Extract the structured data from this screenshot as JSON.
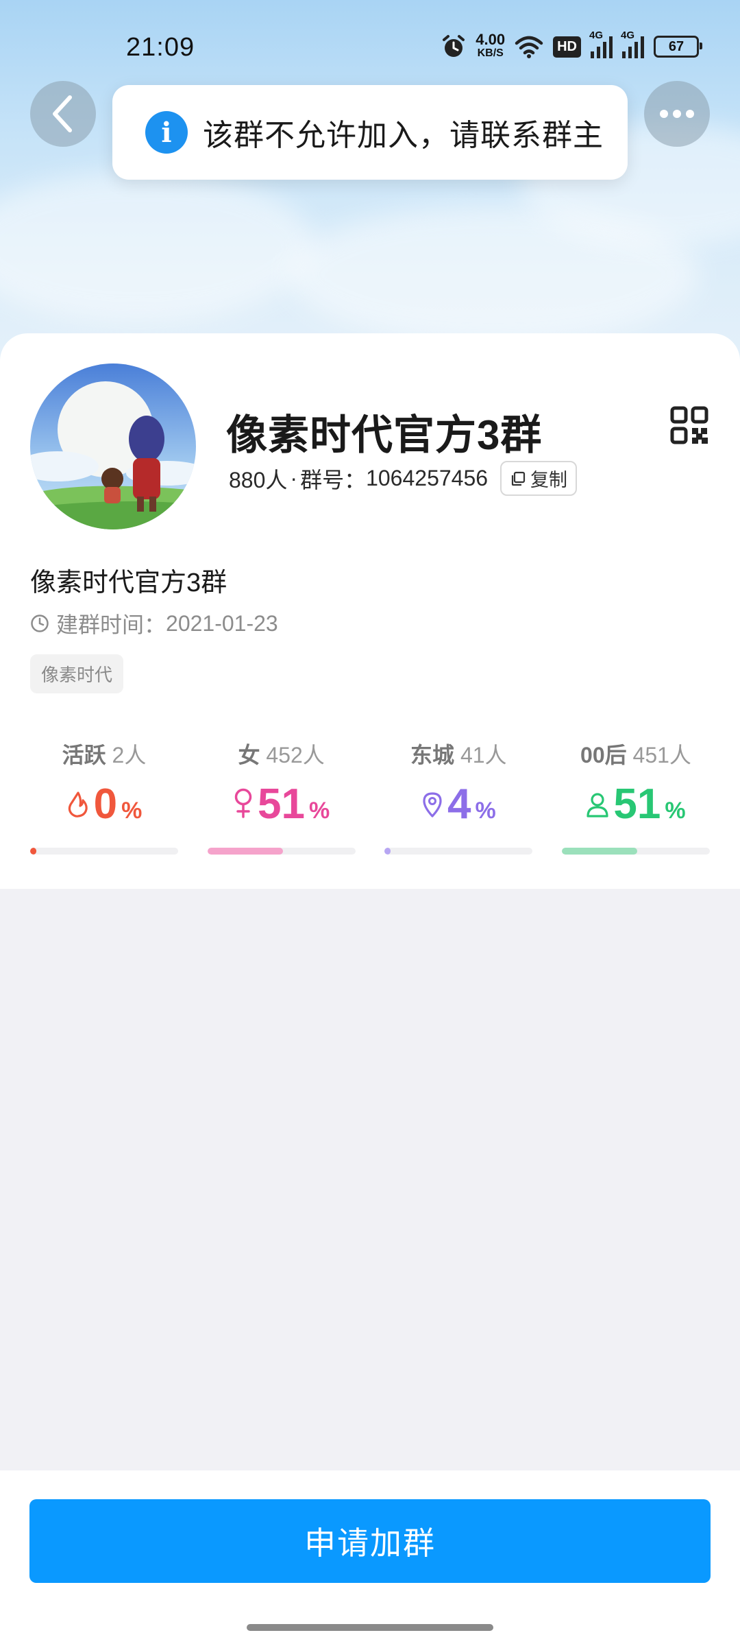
{
  "status_bar": {
    "time": "21:09",
    "net_speed_value": "4.00",
    "net_speed_unit": "KB/S",
    "hd_label": "HD",
    "sim1_label": "4G",
    "sim2_label": "4G",
    "battery": "67"
  },
  "toast": {
    "icon": "info-icon",
    "text": "该群不允许加入，请联系群主"
  },
  "group": {
    "name": "像素时代官方3群",
    "members": "880人",
    "separator": "·",
    "id_label": "群号：",
    "id": "1064257456",
    "copy_label": "复制",
    "description": "像素时代官方3群",
    "created_label": "建群时间：",
    "created_date": "2021-01-23",
    "tag": "像素时代"
  },
  "stats": [
    {
      "key": "活跃",
      "count": "2人",
      "value": "0",
      "unit": "%",
      "percent": 0,
      "color": "#f0573c",
      "bar_color": "#f0573c",
      "icon": "flame-icon"
    },
    {
      "key": "女",
      "count": "452人",
      "value": "51",
      "unit": "%",
      "percent": 51,
      "color": "#e8489a",
      "bar_color": "#f5a3cb",
      "icon": "female-icon"
    },
    {
      "key": "东城",
      "count": "41人",
      "value": "4",
      "unit": "%",
      "percent": 4,
      "color": "#8c6ee8",
      "bar_color": "#b7a6f3",
      "icon": "location-pin-icon"
    },
    {
      "key": "00后",
      "count": "451人",
      "value": "51",
      "unit": "%",
      "percent": 51,
      "color": "#28c774",
      "bar_color": "#9be0bb",
      "icon": "person-icon"
    }
  ],
  "footer": {
    "apply_label": "申请加群"
  },
  "colors": {
    "primary": "#0a99ff",
    "info": "#1d92f0"
  }
}
